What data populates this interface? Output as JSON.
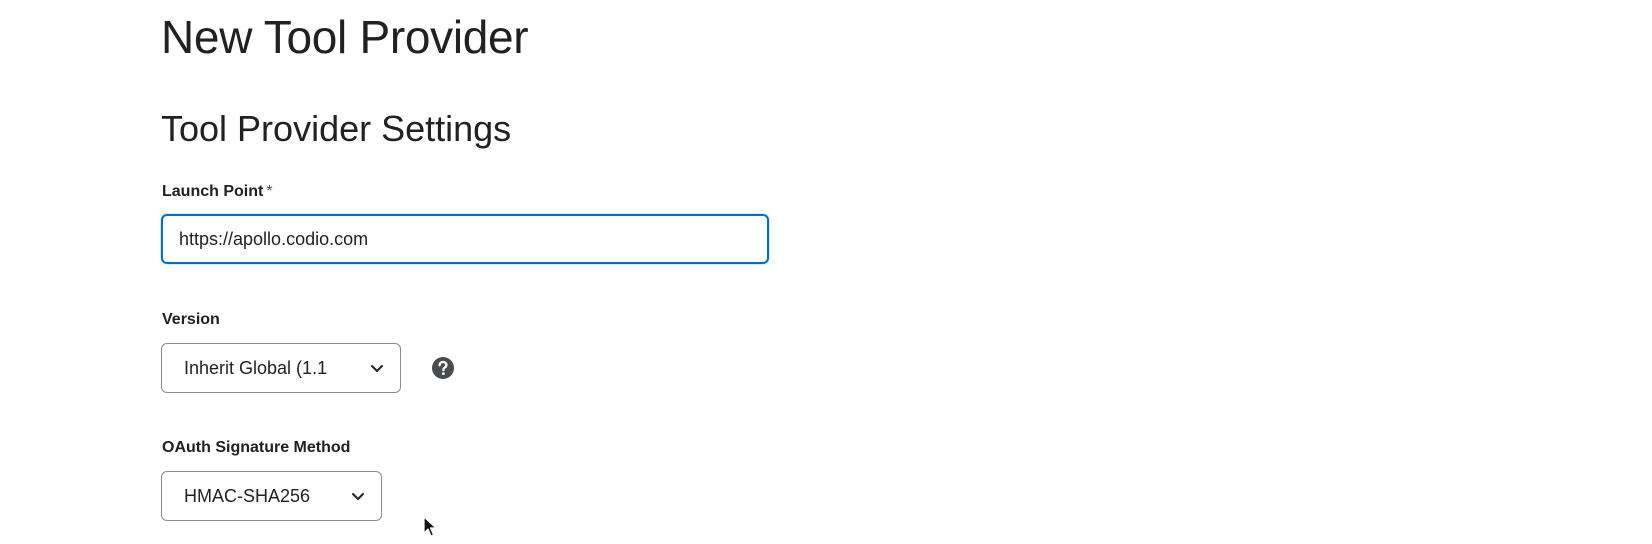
{
  "header": {
    "page_title": "New Tool Provider"
  },
  "section": {
    "title": "Tool Provider Settings"
  },
  "launch_point": {
    "label": "Launch Point",
    "required_marker": "*",
    "value": "https://apollo.codio.com"
  },
  "version": {
    "label": "Version",
    "selected": "Inherit Global (1.1",
    "help_icon": "question-circle-icon"
  },
  "oauth": {
    "label": "OAuth Signature Method",
    "selected": "HMAC-SHA256"
  },
  "colors": {
    "focus_border": "#006fbf",
    "text": "#202122",
    "border": "#868c8f"
  }
}
